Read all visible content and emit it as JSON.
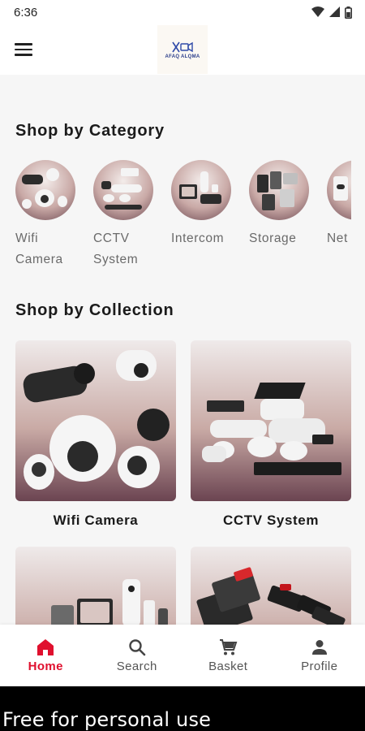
{
  "status_bar": {
    "time": "6:36"
  },
  "app_bar": {
    "logo_text": "AFAQ ALQMA"
  },
  "sections": {
    "category_title": "Shop by Category",
    "collection_title": "Shop by Collection"
  },
  "categories": [
    {
      "line1": "Wifi",
      "line2": "Camera"
    },
    {
      "line1": "CCTV",
      "line2": "System"
    },
    {
      "line1": "Intercom",
      "line2": ""
    },
    {
      "line1": "Storage",
      "line2": ""
    },
    {
      "line1": "Net",
      "line2": ""
    }
  ],
  "collections": [
    {
      "label": "Wifi Camera"
    },
    {
      "label": "CCTV System"
    },
    {
      "label": ""
    },
    {
      "label": ""
    }
  ],
  "bottom_nav": {
    "home": "Home",
    "search": "Search",
    "basket": "Basket",
    "profile": "Profile",
    "active": "home"
  },
  "colors": {
    "accent": "#e0102e",
    "background": "#f6f6f6"
  },
  "watermark": "Free for personal use"
}
